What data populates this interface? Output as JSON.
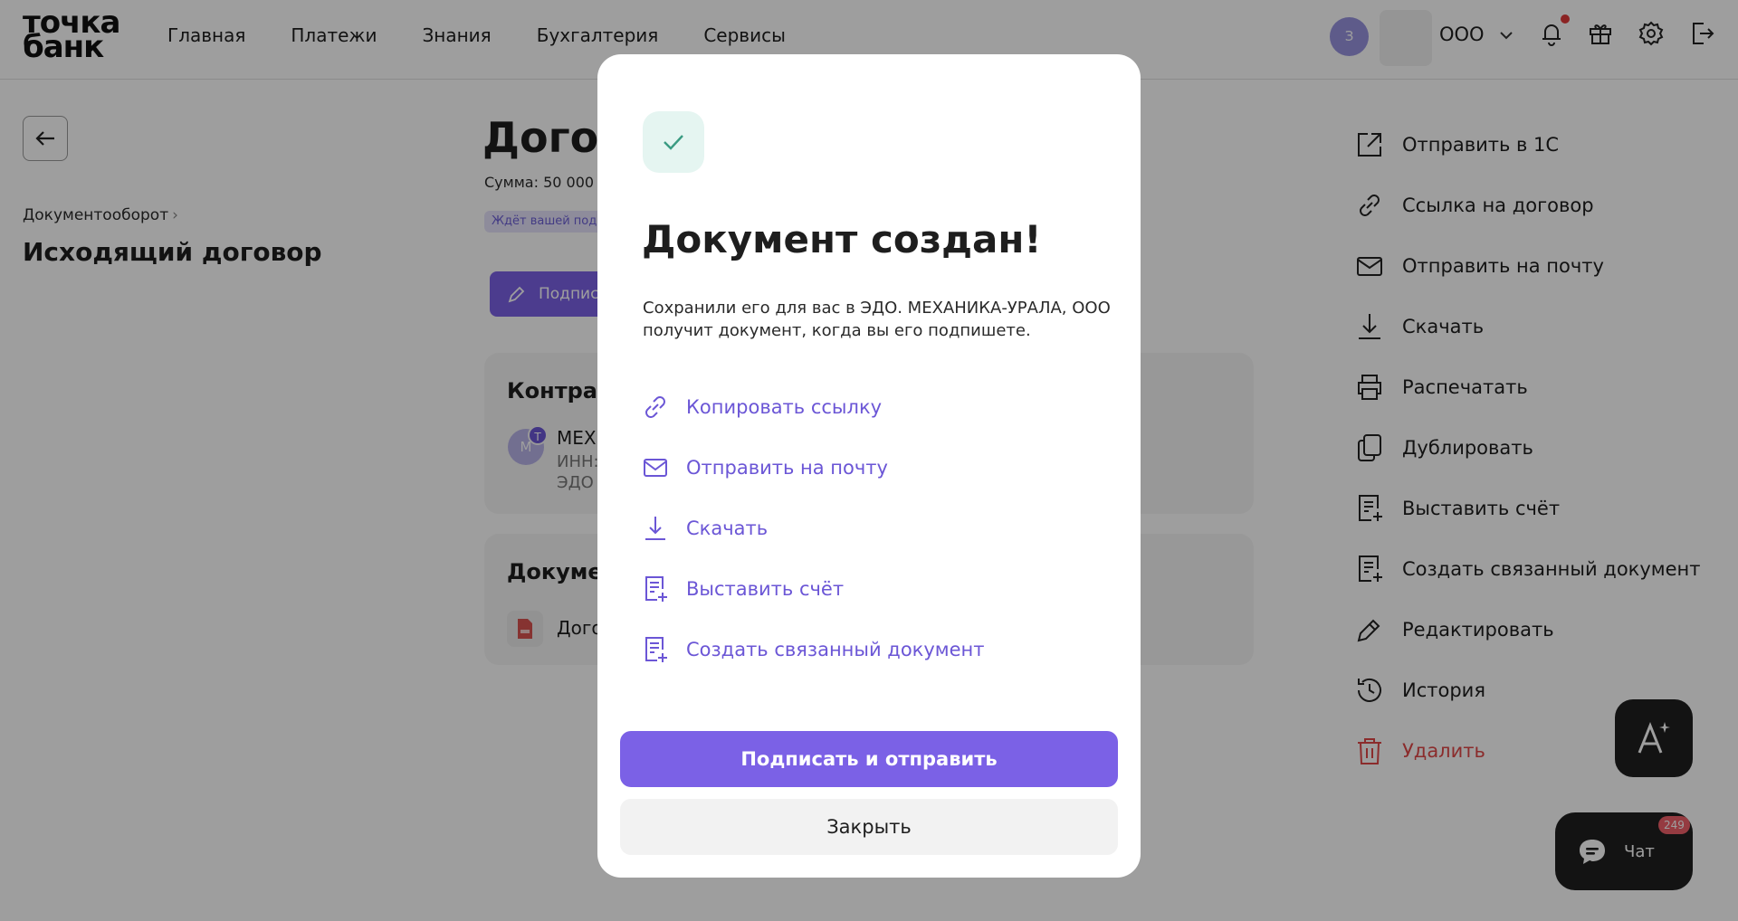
{
  "header": {
    "logo_line1": "точка",
    "logo_line2": "банк",
    "nav": [
      "Главная",
      "Платежи",
      "Знания",
      "Бухгалтерия",
      "Сервисы"
    ],
    "user_initial": "З",
    "org_name": "ООО"
  },
  "left": {
    "breadcrumb": "Документооборот",
    "title": "Исходящий договор"
  },
  "center": {
    "doc_title": "Догов",
    "sum": "Сумма: 50 000",
    "status": "Ждёт вашей под",
    "sign_label": "Подпис",
    "counterparty": {
      "title": "Контраге",
      "avatar": "М",
      "avatar_mini": "Т",
      "name": "МЕХ",
      "inn": "ИНН:",
      "edo": "ЭДО"
    },
    "documents": {
      "title": "Докумен",
      "file_name": "Дого"
    }
  },
  "actions": [
    {
      "label": "Отправить в 1С",
      "icon": "export-icon"
    },
    {
      "label": "Ссылка на договор",
      "icon": "link-icon"
    },
    {
      "label": "Отправить на почту",
      "icon": "mail-icon"
    },
    {
      "label": "Скачать",
      "icon": "download-icon"
    },
    {
      "label": "Распечатать",
      "icon": "printer-icon"
    },
    {
      "label": "Дублировать",
      "icon": "duplicate-icon"
    },
    {
      "label": "Выставить счёт",
      "icon": "invoice-icon"
    },
    {
      "label": "Создать связанный документ",
      "icon": "linked-document-icon"
    },
    {
      "label": "Редактировать",
      "icon": "edit-icon"
    },
    {
      "label": "История",
      "icon": "history-icon"
    },
    {
      "label": "Удалить",
      "icon": "trash-icon",
      "danger": true
    }
  ],
  "chat": {
    "label": "Чат",
    "count": "249"
  },
  "modal": {
    "title": "Документ создан!",
    "text": "Сохранили его для вас в ЭДО. МЕХАНИКА-УРАЛА, ООО получит документ, когда вы его подпишете.",
    "links": [
      {
        "label": "Копировать ссылку",
        "icon": "link-icon"
      },
      {
        "label": "Отправить на почту",
        "icon": "mail-icon"
      },
      {
        "label": "Скачать",
        "icon": "download-icon"
      },
      {
        "label": "Выставить счёт",
        "icon": "invoice-icon"
      },
      {
        "label": "Создать связанный документ",
        "icon": "linked-document-icon"
      }
    ],
    "primary_button": "Подписать и отправить",
    "secondary_button": "Закрыть"
  },
  "colors": {
    "accent": "#7b61e6",
    "link": "#6b56d6",
    "danger": "#e04848",
    "success_bg": "#e5f5f1",
    "success": "#3a9b82"
  }
}
